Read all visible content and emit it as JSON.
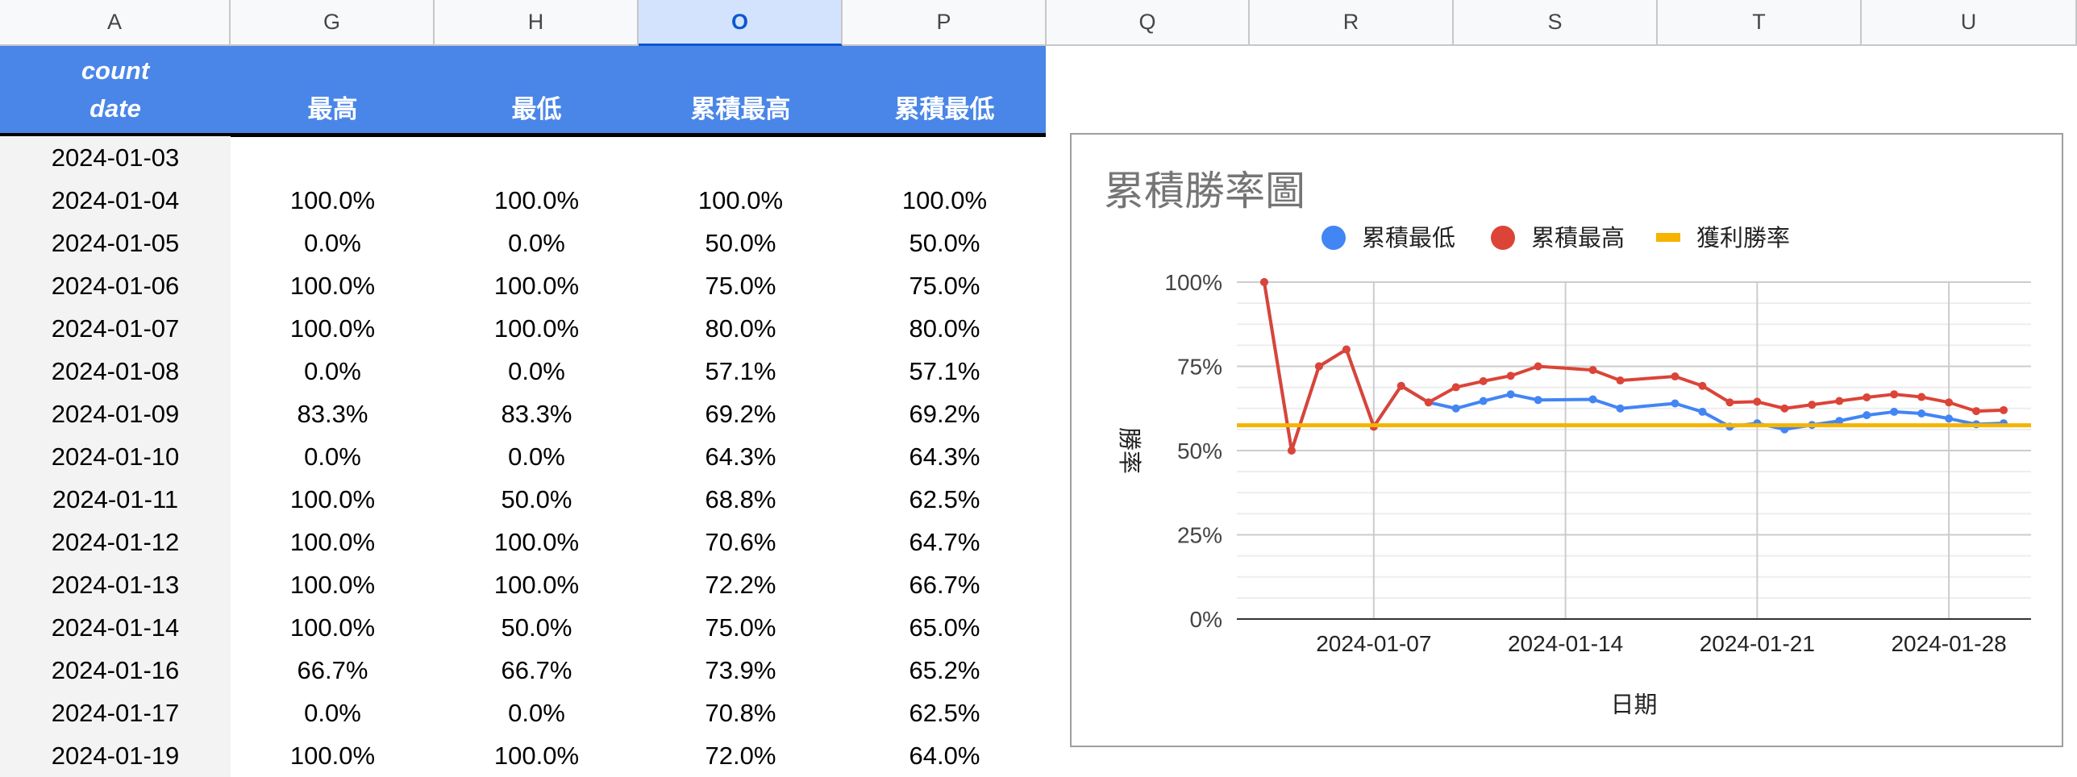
{
  "columns": [
    "A",
    "G",
    "H",
    "O",
    "P",
    "Q",
    "R",
    "S",
    "T",
    "U"
  ],
  "selected_column": "O",
  "table": {
    "header_line1": "count",
    "header_line2": "date",
    "headers": [
      "最高",
      "最低",
      "累積最高",
      "累積最低"
    ],
    "rows": [
      {
        "date": "2024-01-03",
        "cells": [
          "",
          "",
          "",
          ""
        ]
      },
      {
        "date": "2024-01-04",
        "cells": [
          "100.0%",
          "100.0%",
          "100.0%",
          "100.0%"
        ]
      },
      {
        "date": "2024-01-05",
        "cells": [
          "0.0%",
          "0.0%",
          "50.0%",
          "50.0%"
        ]
      },
      {
        "date": "2024-01-06",
        "cells": [
          "100.0%",
          "100.0%",
          "75.0%",
          "75.0%"
        ]
      },
      {
        "date": "2024-01-07",
        "cells": [
          "100.0%",
          "100.0%",
          "80.0%",
          "80.0%"
        ]
      },
      {
        "date": "2024-01-08",
        "cells": [
          "0.0%",
          "0.0%",
          "57.1%",
          "57.1%"
        ]
      },
      {
        "date": "2024-01-09",
        "cells": [
          "83.3%",
          "83.3%",
          "69.2%",
          "69.2%"
        ]
      },
      {
        "date": "2024-01-10",
        "cells": [
          "0.0%",
          "0.0%",
          "64.3%",
          "64.3%"
        ]
      },
      {
        "date": "2024-01-11",
        "cells": [
          "100.0%",
          "50.0%",
          "68.8%",
          "62.5%"
        ]
      },
      {
        "date": "2024-01-12",
        "cells": [
          "100.0%",
          "100.0%",
          "70.6%",
          "64.7%"
        ]
      },
      {
        "date": "2024-01-13",
        "cells": [
          "100.0%",
          "100.0%",
          "72.2%",
          "66.7%"
        ]
      },
      {
        "date": "2024-01-14",
        "cells": [
          "100.0%",
          "50.0%",
          "75.0%",
          "65.0%"
        ]
      },
      {
        "date": "2024-01-16",
        "cells": [
          "66.7%",
          "66.7%",
          "73.9%",
          "65.2%"
        ]
      },
      {
        "date": "2024-01-17",
        "cells": [
          "0.0%",
          "0.0%",
          "70.8%",
          "62.5%"
        ]
      },
      {
        "date": "2024-01-19",
        "cells": [
          "100.0%",
          "100.0%",
          "72.0%",
          "64.0%"
        ]
      }
    ]
  },
  "colors": {
    "header_bg": "#4a86e8",
    "selected_col_bg": "#d3e3fd",
    "date_col_bg": "#f3f3f3"
  },
  "chart_data": {
    "type": "line",
    "title": "累積勝率圖",
    "xlabel": "日期",
    "ylabel": "勝率",
    "ylim": [
      0,
      1
    ],
    "y_ticks": [
      "0%",
      "25%",
      "50%",
      "75%",
      "100%"
    ],
    "x_ticks": [
      "2024-01-07",
      "2024-01-14",
      "2024-01-21",
      "2024-01-28"
    ],
    "x_range": [
      "2024-01-02",
      "2024-01-31"
    ],
    "legend_position": "top",
    "grid": true,
    "series": [
      {
        "name": "累積最低",
        "color": "#4285f4",
        "marker": true,
        "points": [
          [
            "2024-01-03",
            1.0
          ],
          [
            "2024-01-04",
            0.5
          ],
          [
            "2024-01-05",
            0.75
          ],
          [
            "2024-01-06",
            0.8
          ],
          [
            "2024-01-07",
            0.571
          ],
          [
            "2024-01-08",
            0.692
          ],
          [
            "2024-01-09",
            0.643
          ],
          [
            "2024-01-10",
            0.625
          ],
          [
            "2024-01-11",
            0.647
          ],
          [
            "2024-01-12",
            0.667
          ],
          [
            "2024-01-13",
            0.65
          ],
          [
            "2024-01-15",
            0.652
          ],
          [
            "2024-01-16",
            0.625
          ],
          [
            "2024-01-18",
            0.64
          ],
          [
            "2024-01-19",
            0.615
          ],
          [
            "2024-01-20",
            0.571
          ],
          [
            "2024-01-21",
            0.581
          ],
          [
            "2024-01-22",
            0.563
          ],
          [
            "2024-01-23",
            0.576
          ],
          [
            "2024-01-24",
            0.588
          ],
          [
            "2024-01-25",
            0.605
          ],
          [
            "2024-01-26",
            0.615
          ],
          [
            "2024-01-27",
            0.61
          ],
          [
            "2024-01-28",
            0.595
          ],
          [
            "2024-01-29",
            0.578
          ],
          [
            "2024-01-30",
            0.581
          ]
        ]
      },
      {
        "name": "累積最高",
        "color": "#db4437",
        "marker": true,
        "points": [
          [
            "2024-01-03",
            1.0
          ],
          [
            "2024-01-04",
            0.5
          ],
          [
            "2024-01-05",
            0.75
          ],
          [
            "2024-01-06",
            0.8
          ],
          [
            "2024-01-07",
            0.571
          ],
          [
            "2024-01-08",
            0.692
          ],
          [
            "2024-01-09",
            0.643
          ],
          [
            "2024-01-10",
            0.688
          ],
          [
            "2024-01-11",
            0.706
          ],
          [
            "2024-01-12",
            0.722
          ],
          [
            "2024-01-13",
            0.75
          ],
          [
            "2024-01-15",
            0.739
          ],
          [
            "2024-01-16",
            0.708
          ],
          [
            "2024-01-18",
            0.72
          ],
          [
            "2024-01-19",
            0.692
          ],
          [
            "2024-01-20",
            0.643
          ],
          [
            "2024-01-21",
            0.645
          ],
          [
            "2024-01-22",
            0.625
          ],
          [
            "2024-01-23",
            0.636
          ],
          [
            "2024-01-24",
            0.647
          ],
          [
            "2024-01-25",
            0.658
          ],
          [
            "2024-01-26",
            0.667
          ],
          [
            "2024-01-27",
            0.659
          ],
          [
            "2024-01-28",
            0.643
          ],
          [
            "2024-01-29",
            0.617
          ],
          [
            "2024-01-30",
            0.62
          ]
        ]
      },
      {
        "name": "獲利勝率",
        "color": "#f4b400",
        "marker": false,
        "points": [
          [
            "2024-01-02",
            0.575
          ],
          [
            "2024-01-31",
            0.575
          ]
        ]
      }
    ]
  }
}
